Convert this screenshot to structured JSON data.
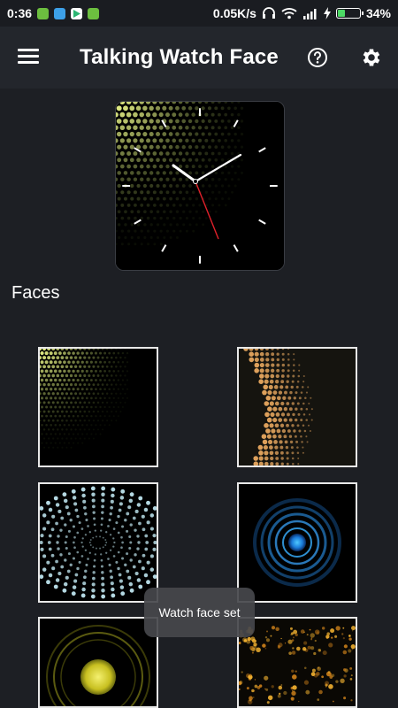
{
  "status_bar": {
    "time": "0:36",
    "network_speed": "0.05K/s",
    "battery_percent": "34%",
    "battery_level": 0.34,
    "icons": [
      "notification-app-icon",
      "gallery-app-icon",
      "play-store-icon",
      "android-app-icon",
      "headphones-icon",
      "wifi-icon",
      "signal-icon",
      "charging-icon",
      "battery-icon"
    ]
  },
  "app_bar": {
    "title": "Talking Watch Face",
    "menu_icon": "hamburger-menu-icon",
    "help_icon": "help-circle-icon",
    "settings_icon": "gear-icon"
  },
  "faces_section": {
    "title": "Faces",
    "faces": [
      {
        "name": "green-dots-face"
      },
      {
        "name": "orange-wave-face"
      },
      {
        "name": "blue-tunnel-face"
      },
      {
        "name": "blue-rings-face"
      },
      {
        "name": "yellow-orb-face"
      },
      {
        "name": "gold-particles-face"
      }
    ]
  },
  "toast": {
    "message": "Watch face set"
  },
  "colors": {
    "background": "#1d1f24",
    "app_bar": "#23262c",
    "accent_green": "#4cd964",
    "second_hand": "#e0202a"
  }
}
